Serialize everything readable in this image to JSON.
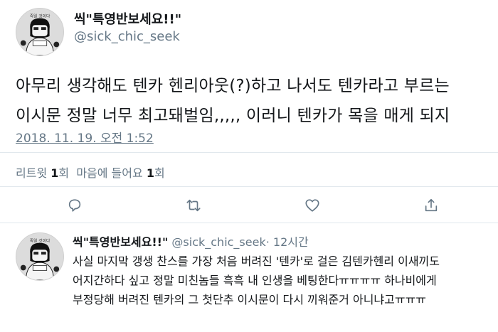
{
  "tweet": {
    "display_name": "씩\"특영반보세요!!\"",
    "handle": "@sick_chic_seek",
    "avatar_text": "죽일 것이다",
    "text_line1": "아무리 생각해도 텐카 헨리아웃(?)하고 나서도 텐카라고 부르는",
    "text_line2": "이시문 정말 너무 최고돼벌임,,,,, 이러니 텐카가 목을 매게 되지",
    "timestamp": "2018. 11. 19. 오전 1:52"
  },
  "stats": {
    "retweets_label": "리트윗",
    "retweets_count": "1",
    "retweets_unit": "회",
    "likes_label": "마음에 들어요",
    "likes_count": "1",
    "likes_unit": "회"
  },
  "actions": [
    {
      "icon": "reply-icon"
    },
    {
      "icon": "retweet-icon"
    },
    {
      "icon": "like-icon"
    },
    {
      "icon": "share-icon"
    }
  ],
  "reply": {
    "display_name": "씩\"특영반보세요!!\"",
    "handle": "@sick_chic_seek",
    "time": "· 12시간",
    "text_line1": "사실 마지막 갱생 찬스를 가장 처음 버려진 '텐카'로 걸은 김텐카헨리 이새끼도",
    "text_line2": "어지간하다 싶고 정말 미친놈들 흑흑 내 인생을 베팅한다ㅠㅠㅠㅠ 하나비에게",
    "text_line3": "부정당해 버려진 텐카의 그 첫단추 이시문이 다시 끼워준거 아니냐고ㅠㅠㅠ"
  }
}
